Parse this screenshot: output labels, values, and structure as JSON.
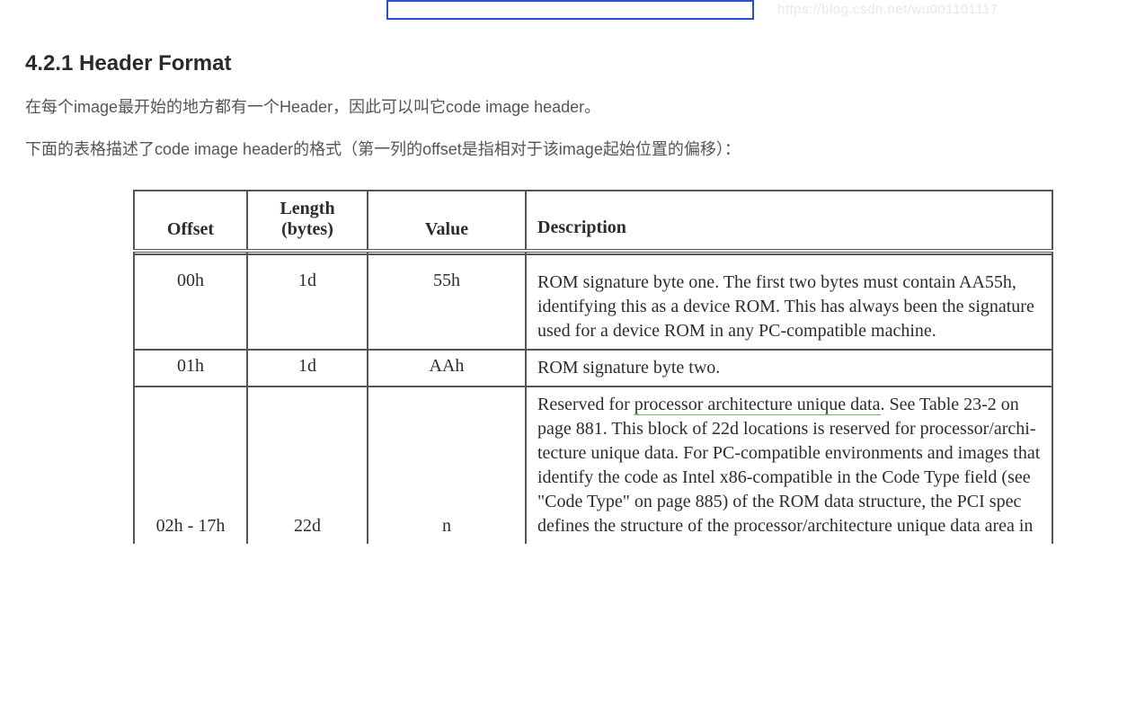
{
  "watermark": "https://blog.csdn.net/wu001101117",
  "section_title": "4.2.1 Header Format",
  "para1": "在每个image最开始的地方都有一个Header，因此可以叫它code image header。",
  "para2": "下面的表格描述了code image header的格式（第一列的offset是指相对于该image起始位置的偏移）：",
  "table": {
    "headers": {
      "offset": "Offset",
      "length_line1": "Length",
      "length_line2": "(bytes)",
      "value": "Value",
      "description": "Description"
    },
    "rows": [
      {
        "offset": "00h",
        "length": "1d",
        "value": "55h",
        "description": "ROM signature byte one. The first two bytes must contain AA55h, identifying this as a device ROM. This has always been the signa­ture used for a device ROM in any PC-compat­ible machine."
      },
      {
        "offset": "01h",
        "length": "1d",
        "value": "AAh",
        "description": "ROM signature byte two."
      },
      {
        "offset": "02h - 17h",
        "length": "22d",
        "value": "n",
        "desc_prefix": "Reserved for ",
        "desc_underlined": "processor architecture unique data",
        "desc_suffix": ". See Table 23-2 on page 881. This block of 22d locations is reserved for processor/archi­tecture unique data. For PC-compatible envi­ronments and images that identify the code as Intel x86-compatible in the Code Type field (see \"Code Type\" on page 885) of the ROM data structure, the PCI spec defines the structure of the processor/architecture unique data area in"
      }
    ]
  }
}
